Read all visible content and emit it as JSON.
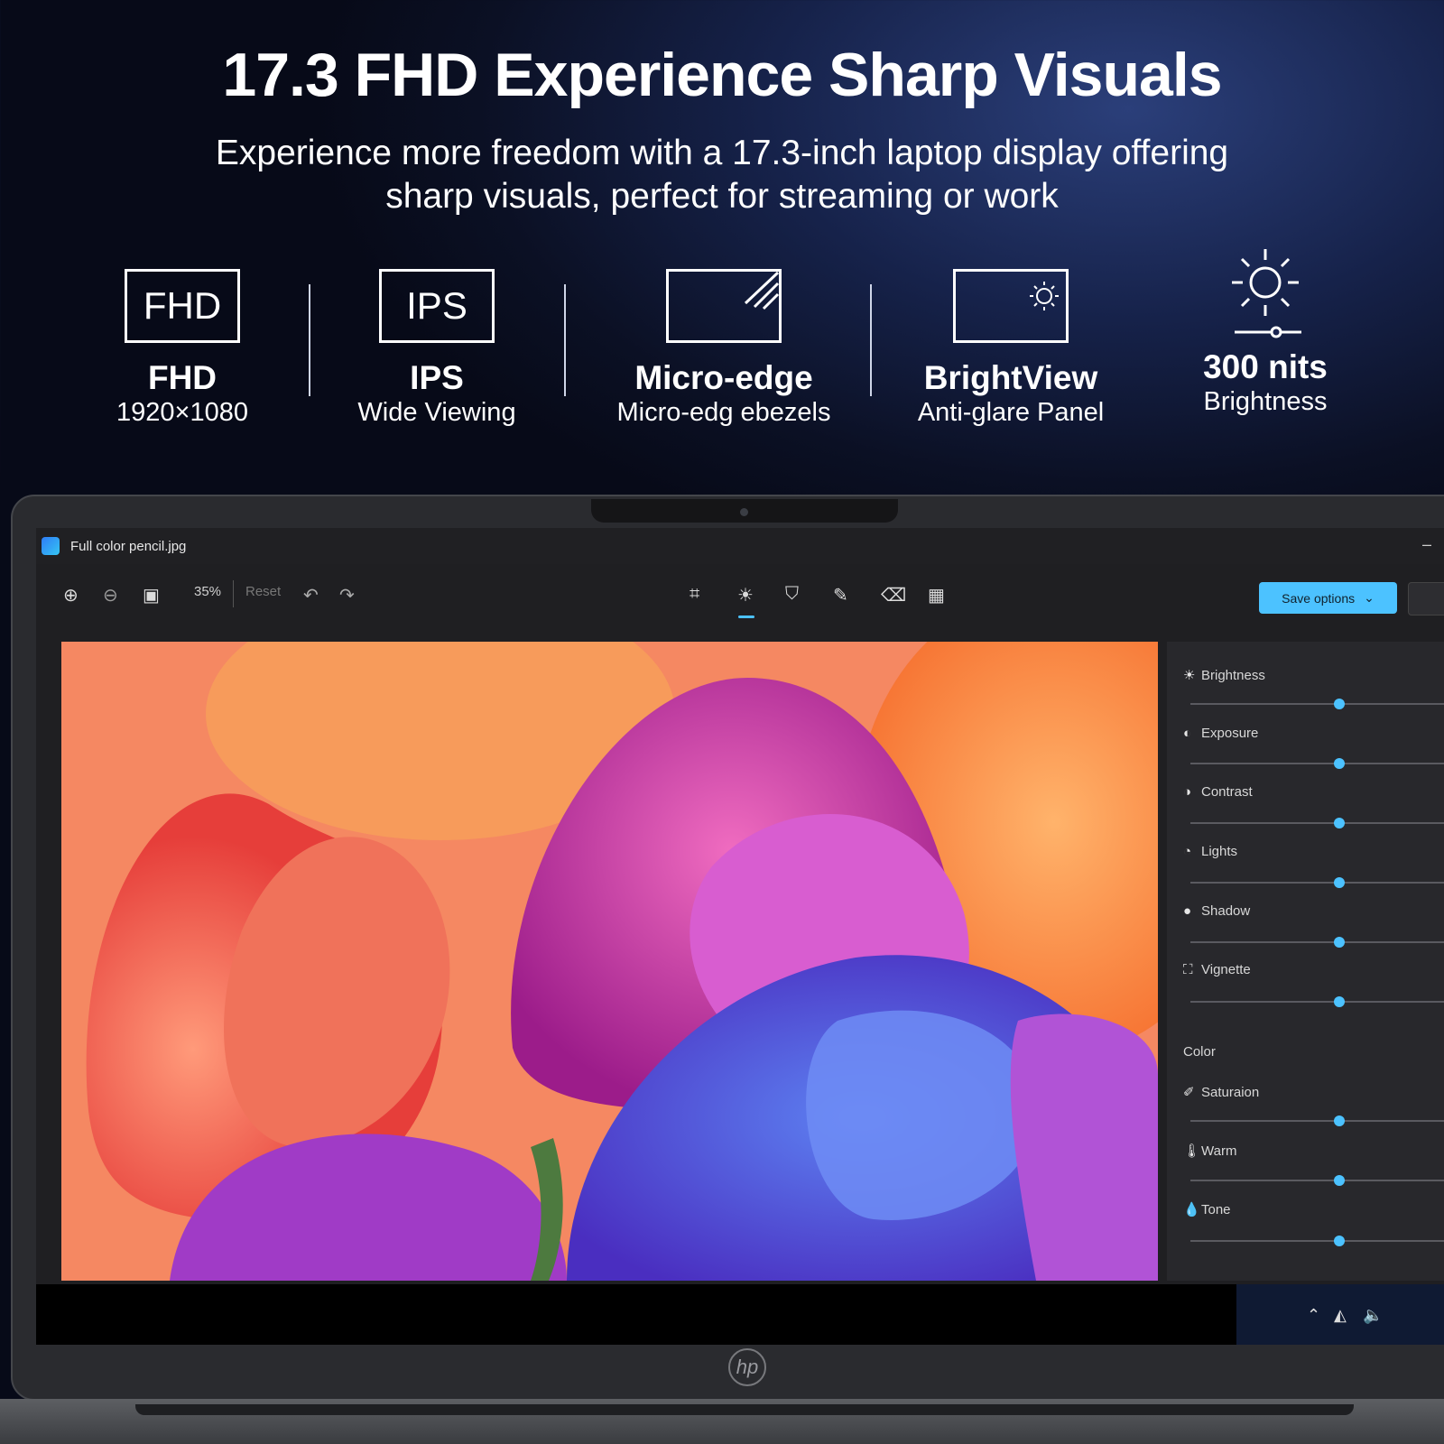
{
  "hero": {
    "title": "17.3 FHD Experience Sharp Visuals",
    "subtitle_line1": "Experience more freedom with a 17.3-inch laptop display offering",
    "subtitle_line2": "sharp visuals, perfect for streaming or work"
  },
  "features": [
    {
      "icon_text": "FHD",
      "title": "FHD",
      "subtitle": "1920×1080"
    },
    {
      "icon_text": "IPS",
      "title": "IPS",
      "subtitle": "Wide Viewing"
    },
    {
      "icon": "micro-edge-screen-icon",
      "title": "Micro-edge",
      "subtitle": "Micro-edg ebezels"
    },
    {
      "icon": "sun-screen-icon",
      "title": "BrightView",
      "subtitle": "Anti-glare Panel"
    },
    {
      "icon": "sun-slider-icon",
      "title": "300 nits",
      "subtitle": "Brightness"
    }
  ],
  "app": {
    "window_title": "Full color pencil.jpg",
    "zoom": "35%",
    "reset_label": "Reset",
    "save_label": "Save options",
    "color_section": "Color",
    "adjustments": [
      {
        "label": "Brightness",
        "icon": "sun-icon",
        "value": 0.55
      },
      {
        "label": "Exposure",
        "icon": "exposure-icon",
        "value": 0.55
      },
      {
        "label": "Contrast",
        "icon": "contrast-icon",
        "value": 0.55
      },
      {
        "label": "Lights",
        "icon": "lights-icon",
        "value": 0.55
      },
      {
        "label": "Shadow",
        "icon": "shadow-icon",
        "value": 0.55
      },
      {
        "label": "Vignette",
        "icon": "vignette-icon",
        "value": 0.55
      }
    ],
    "color_adjustments": [
      {
        "label": "Saturaion",
        "icon": "saturation-icon",
        "value": 0.55
      },
      {
        "label": "Warm",
        "icon": "warm-icon",
        "value": 0.55
      },
      {
        "label": "Tone",
        "icon": "tone-icon",
        "value": 0.55
      }
    ]
  },
  "brand": {
    "logo": "hp"
  },
  "colors": {
    "accent": "#4cc2ff",
    "background": "#0b1024"
  }
}
